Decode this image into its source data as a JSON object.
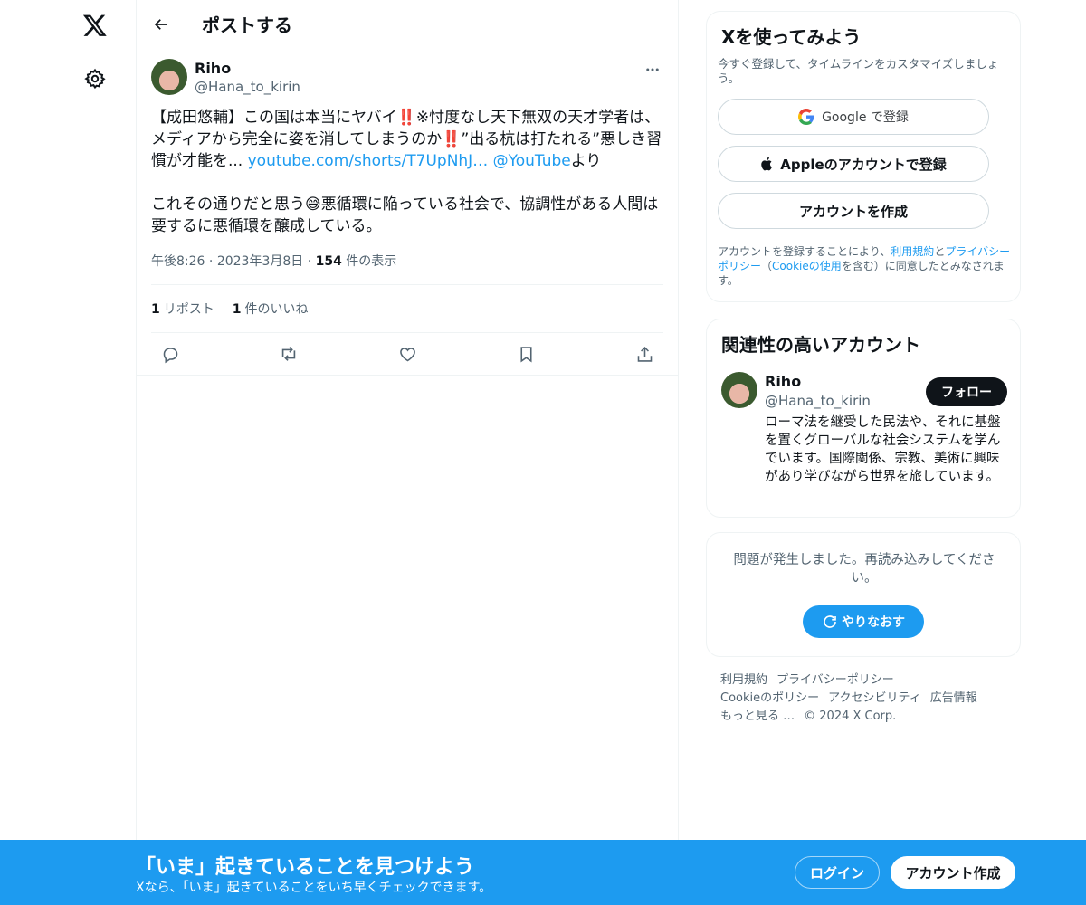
{
  "header": {
    "title": "ポストする"
  },
  "tweet": {
    "author_name": "Riho",
    "author_handle": "@Hana_to_kirin",
    "text_part1": "【成田悠輔】この国は本当にヤバイ‼️※忖度なし天下無双の天才学者は、メディアから完全に姿を消してしまうのか‼️”出る杭は打たれる”悪しき習慣が才能を... ",
    "link_url": "youtube.com/shorts/T7UpNhJ…",
    "space": " ",
    "link_mention": "@YouTube",
    "text_part2": "より\n\nこれその通りだと思う😅悪循環に陥っている社会で、協調性がある人間は要するに悪循環を醸成している。",
    "time": "午後8:26",
    "dot1": " · ",
    "date": "2023年3月8日",
    "dot2": " · ",
    "views_count": "154",
    "views_label": " 件の表示",
    "reposts_count": "1",
    "reposts_label": "リポスト",
    "likes_count": "1",
    "likes_label": "件のいいね"
  },
  "signup": {
    "title": "Xを使ってみよう",
    "subtitle": "今すぐ登録して、タイムラインをカスタマイズしましょう。",
    "google_label": "Google で登録",
    "apple_label": "Appleのアカウントで登録",
    "create_label": "アカウントを作成",
    "terms_prefix": "アカウントを登録することにより、",
    "terms_link": "利用規約",
    "terms_and": "と",
    "privacy_link": "プライバシーポリシー",
    "terms_paren_open": "（",
    "cookie_link": "Cookieの使用",
    "terms_suffix": "を含む）に同意したとみなされます。"
  },
  "related": {
    "title": "関連性の高いアカウント",
    "name": "Riho",
    "handle": "@Hana_to_kirin",
    "follow_label": "フォロー",
    "bio": "ローマ法を継受した民法や、それに基盤を置くグローバルな社会システムを学んでいます。国際関係、宗教、美術に興味があり学びながら世界を旅しています。"
  },
  "error": {
    "message": "問題が発生しました。再読み込みしてください。",
    "retry_label": "やりなおす"
  },
  "footer": {
    "links": [
      "利用規約",
      "プライバシーポリシー",
      "Cookieのポリシー",
      "アクセシビリティ",
      "広告情報",
      "もっと見る …"
    ],
    "copyright": "© 2024 X Corp."
  },
  "bottom_bar": {
    "title": "「いま」起きていることを見つけよう",
    "subtitle": "Xなら、「いま」起きていることをいち早くチェックできます。",
    "login_label": "ログイン",
    "signup_label": "アカウント作成"
  },
  "colors": {
    "accent": "#1d9bf0",
    "text": "#0f1419",
    "secondary": "#536471",
    "border": "#eff3f4"
  },
  "icons": [
    "x-logo-icon",
    "settings-gear-icon",
    "back-arrow-icon",
    "more-icon",
    "reply-icon",
    "repost-icon",
    "like-icon",
    "bookmark-icon",
    "share-icon",
    "google-icon",
    "apple-icon",
    "refresh-icon"
  ]
}
